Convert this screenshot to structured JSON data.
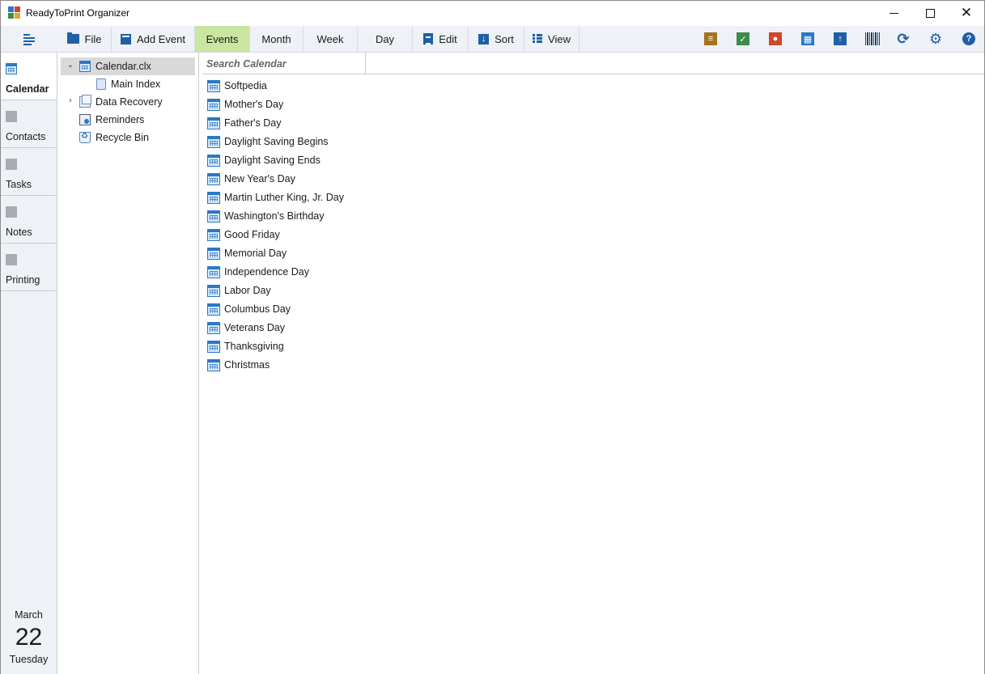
{
  "window": {
    "title": "ReadyToPrint Organizer"
  },
  "toolbar": {
    "file": "File",
    "add_event": "Add Event",
    "tabs": [
      "Events",
      "Month",
      "Week",
      "Day"
    ],
    "edit": "Edit",
    "sort": "Sort",
    "view": "View"
  },
  "right_toolbar_icons": [
    "notes-icon",
    "tasks-icon",
    "contacts-icon",
    "calendar-icon",
    "upload-icon",
    "barcode-icon",
    "refresh-icon",
    "settings-icon",
    "help-icon"
  ],
  "colors": {
    "active_tab": "#c9e6a1",
    "accent": "#1f5fa8",
    "notes": "#a5731b",
    "tasks": "#3f8a4b",
    "contacts": "#d0462c",
    "calendar": "#2b78c4"
  },
  "nav": {
    "items": [
      {
        "label": "Calendar",
        "active": true
      },
      {
        "label": "Contacts",
        "active": false
      },
      {
        "label": "Tasks",
        "active": false
      },
      {
        "label": "Notes",
        "active": false
      },
      {
        "label": "Printing",
        "active": false
      }
    ]
  },
  "date": {
    "month": "March",
    "day": "22",
    "weekday": "Tuesday"
  },
  "tree": {
    "items": [
      {
        "label": "Calendar.clx",
        "selected": true,
        "expanded": true
      },
      {
        "label": "Main Index"
      },
      {
        "label": "Data Recovery",
        "collapsed": true
      },
      {
        "label": "Reminders"
      },
      {
        "label": "Recycle Bin"
      }
    ]
  },
  "search": {
    "placeholder": "Search Calendar",
    "value": ""
  },
  "events": [
    "Softpedia",
    "Mother's Day",
    "Father's Day",
    "Daylight Saving Begins",
    "Daylight Saving Ends",
    "New Year's Day",
    "Martin Luther King, Jr. Day",
    "Washington's Birthday",
    "Good Friday",
    "Memorial Day",
    "Independence Day",
    "Labor Day",
    "Columbus Day",
    "Veterans Day",
    "Thanksgiving",
    "Christmas"
  ]
}
